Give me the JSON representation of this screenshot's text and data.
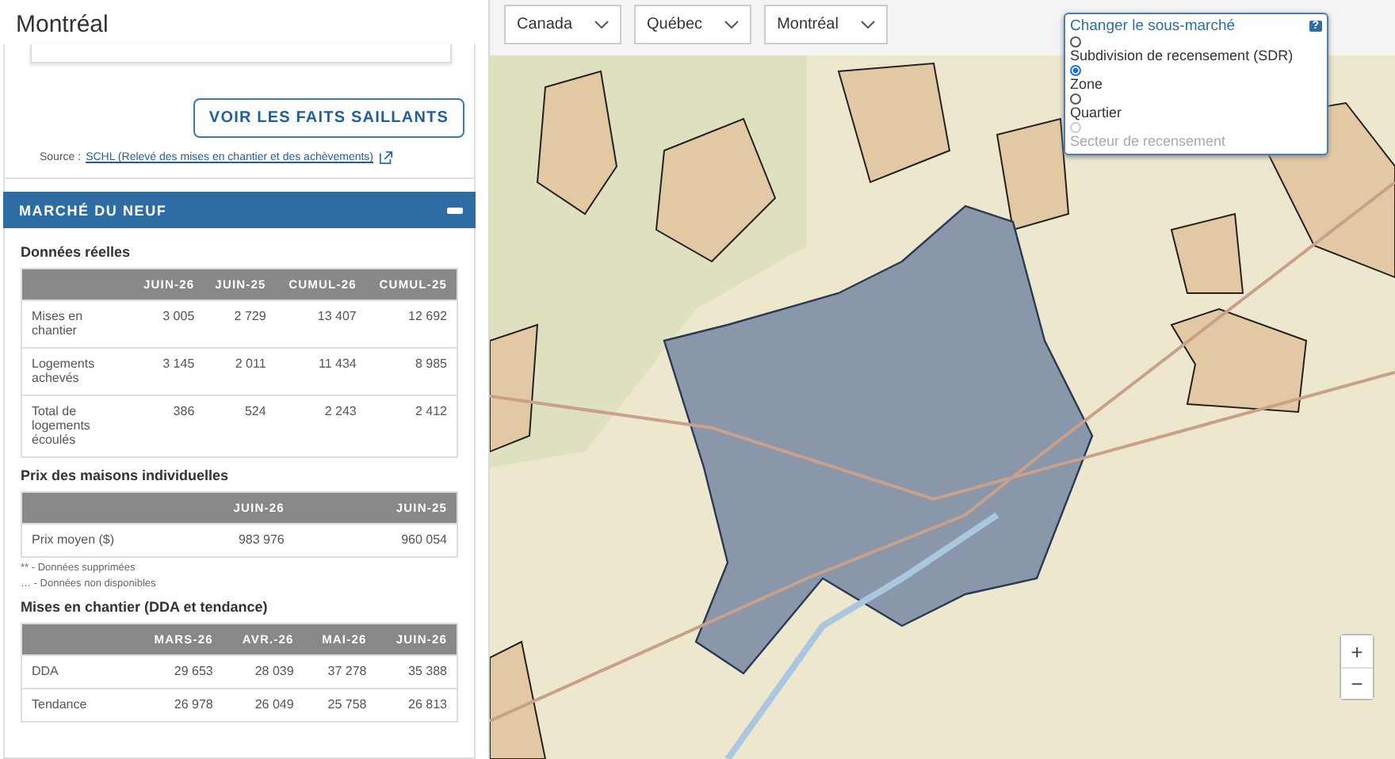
{
  "header": {
    "title": "Montréal"
  },
  "highlights_button": "VOIR LES FAITS SAILLANTS",
  "source": {
    "label": "Source :",
    "link": "SCHL (Relevé des mises en chantier et des achèvements)"
  },
  "section": {
    "title": "MARCHÉ DU NEUF",
    "expanded": true
  },
  "tables": [
    {
      "title": "Données réelles",
      "columns": [
        "JUIN-26",
        "JUIN-25",
        "CUMUL-26",
        "CUMUL-25"
      ],
      "rows": [
        {
          "label": "Mises en chantier",
          "values": [
            "3 005",
            "2 729",
            "13 407",
            "12 692"
          ]
        },
        {
          "label": "Logements achevés",
          "values": [
            "3 145",
            "2 011",
            "11 434",
            "8 985"
          ]
        },
        {
          "label": "Total de logements écoulés",
          "values": [
            "386",
            "524",
            "2 243",
            "2 412"
          ]
        }
      ]
    },
    {
      "title": "Prix des maisons individuelles",
      "columns": [
        "JUIN-26",
        "JUIN-25"
      ],
      "rows": [
        {
          "label": "Prix moyen ($)",
          "values": [
            "983 976",
            "960 054"
          ]
        }
      ],
      "notes": [
        "** - Données supprimées",
        "… - Données non disponibles"
      ]
    },
    {
      "title": "Mises en chantier (DDA et tendance)",
      "columns": [
        "MARS-26",
        "AVR.-26",
        "MAI-26",
        "JUIN-26"
      ],
      "rows": [
        {
          "label": "DDA",
          "values": [
            "29 653",
            "28 039",
            "37 278",
            "35 388"
          ]
        },
        {
          "label": "Tendance",
          "values": [
            "26 978",
            "26 049",
            "25 758",
            "26 813"
          ]
        }
      ]
    }
  ],
  "filters": [
    {
      "value": "Canada"
    },
    {
      "value": "Québec"
    },
    {
      "value": "Montréal"
    }
  ],
  "submarket_popup": {
    "title": "Changer le sous-marché",
    "help": "?",
    "options": [
      {
        "label": "Subdivision de recensement (SDR)",
        "selected": false,
        "disabled": false
      },
      {
        "label": "Zone",
        "selected": true,
        "disabled": false
      },
      {
        "label": "Quartier",
        "selected": false,
        "disabled": false
      },
      {
        "label": "Secteur de recensement",
        "selected": false,
        "disabled": true
      }
    ]
  },
  "zoom": {
    "in": "+",
    "out": "−"
  }
}
